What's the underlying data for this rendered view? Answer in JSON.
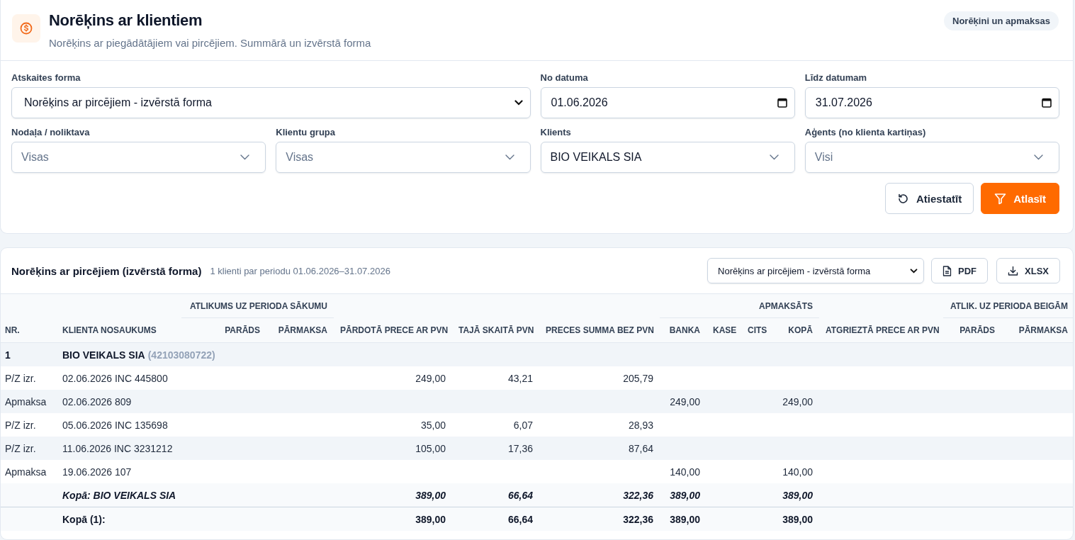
{
  "header": {
    "title": "Norēķins ar klientiem",
    "subtitle": "Norēķins ar piegādātājiem vai pircējiem. Summārā un izvērstā forma",
    "badge": "Norēķini un apmaksas"
  },
  "filters": [
    {
      "kind": "select",
      "label": "Atskaites forma",
      "value": "Norēķins ar pircējiem - izvērstā forma"
    },
    {
      "kind": "date",
      "label": "No datuma",
      "value": "01.06.2026"
    },
    {
      "kind": "date",
      "label": "Līdz datumam",
      "value": "31.07.2026"
    },
    {
      "kind": "combo",
      "label": "Nodaļa / noliktava",
      "placeholder": "Visas"
    },
    {
      "kind": "combo",
      "label": "Klientu grupa",
      "placeholder": "Visas"
    },
    {
      "kind": "combo",
      "label": "Klients",
      "value": "BIO VEIKALS SIA"
    },
    {
      "kind": "combo",
      "label": "Aģents (no klienta kartiņas)",
      "placeholder": "Visi"
    }
  ],
  "actions": {
    "reset": "Atiestatīt",
    "apply": "Atlasīt"
  },
  "report": {
    "title": "Norēķins ar pircējiem (izvērstā forma)",
    "summary": "1 klienti par periodu 01.06.2026–31.07.2026",
    "form_select": "Norēķins ar pircējiem - izvērstā forma",
    "exports": [
      "PDF",
      "XLSX"
    ]
  },
  "table": {
    "column_groups": [
      "ATLIKUMS UZ PERIODA SĀKUMU",
      "APMAKSĀTS",
      "ATLIK. UZ PERIODA BEIGĀM"
    ],
    "columns": [
      "NR.",
      "KLIENTA NOSAUKUMS",
      "PARĀDS",
      "PĀRMAKSA",
      "PĀRDOTĀ PRECE AR PVN",
      "TAJĀ SKAITĀ PVN",
      "PRECES SUMMA BEZ PVN",
      "BANKA",
      "KASE",
      "CITS",
      "KOPĀ",
      "ATGRIEZTĀ PRECE AR PVN",
      "PARĀDS",
      "PĀRMAKSA"
    ],
    "rows": [
      {
        "kind": "group",
        "cells": [
          "1",
          "BIO VEIKALS SIA",
          null,
          null,
          null,
          null,
          null,
          null,
          null,
          null,
          null,
          null,
          null,
          null
        ],
        "code": "(42103080722)"
      },
      {
        "kind": "detail",
        "cells": [
          "P/Z izr.",
          "02.06.2026 INC 445800",
          null,
          null,
          "249,00",
          "43,21",
          "205,79",
          null,
          null,
          null,
          null,
          null,
          null,
          null
        ]
      },
      {
        "kind": "detail",
        "cells": [
          "Apmaksa",
          "02.06.2026 809",
          null,
          null,
          null,
          null,
          null,
          "249,00",
          null,
          null,
          "249,00",
          null,
          null,
          null
        ]
      },
      {
        "kind": "detail",
        "cells": [
          "P/Z izr.",
          "05.06.2026 INC 135698",
          null,
          null,
          "35,00",
          "6,07",
          "28,93",
          null,
          null,
          null,
          null,
          null,
          null,
          null
        ]
      },
      {
        "kind": "detail",
        "cells": [
          "P/Z izr.",
          "11.06.2026 INC 3231212",
          null,
          null,
          "105,00",
          "17,36",
          "87,64",
          null,
          null,
          null,
          null,
          null,
          null,
          null
        ]
      },
      {
        "kind": "detail",
        "cells": [
          "Apmaksa",
          "19.06.2026 107",
          null,
          null,
          null,
          null,
          null,
          "140,00",
          null,
          null,
          "140,00",
          null,
          null,
          null
        ]
      },
      {
        "kind": "subtotal",
        "cells": [
          null,
          "Kopā: BIO VEIKALS SIA",
          null,
          null,
          "389,00",
          "66,64",
          "322,36",
          "389,00",
          null,
          null,
          "389,00",
          null,
          null,
          null
        ]
      },
      {
        "kind": "total",
        "cells": [
          null,
          "Kopā (1):",
          null,
          null,
          "389,00",
          "66,64",
          "322,36",
          "389,00",
          null,
          null,
          "389,00",
          null,
          null,
          null
        ]
      }
    ]
  }
}
